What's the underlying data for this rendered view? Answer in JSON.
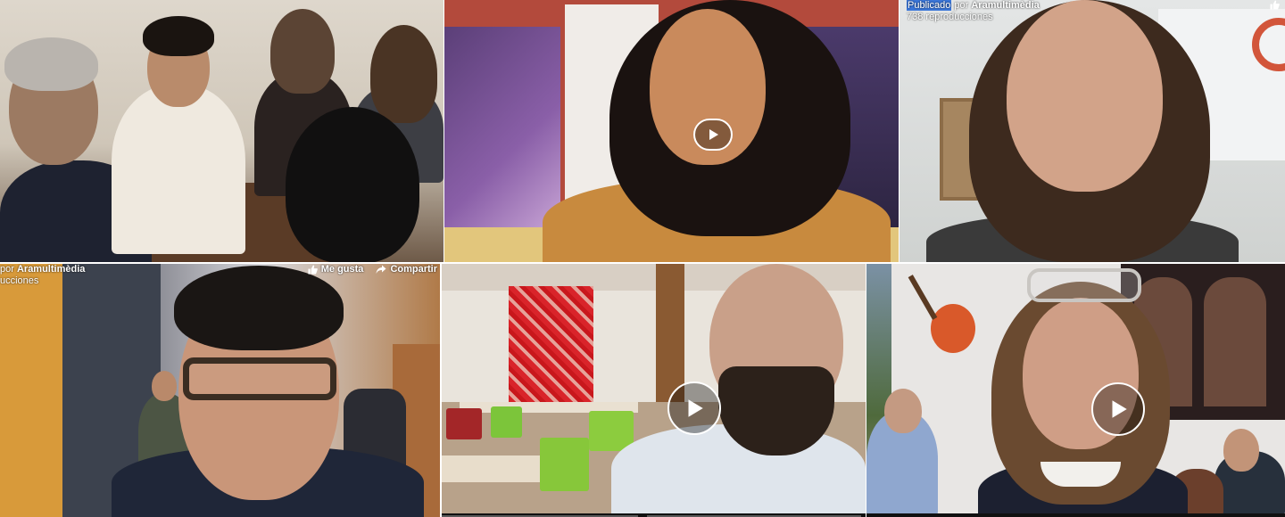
{
  "colors": {
    "facebook_highlight": "#3a76d9",
    "overlay_text": "#ffffff"
  },
  "tiles": [
    {
      "id": "tile-1",
      "has_play": false
    },
    {
      "id": "tile-2",
      "has_play": true
    },
    {
      "id": "tile-3",
      "has_play": false,
      "overlay": {
        "published_word": "Publicado",
        "by_word": "por",
        "publisher": "Aramultimèdia",
        "views": "738 reproducciones"
      },
      "like_icon": "thumbs-up-icon"
    },
    {
      "id": "tile-4",
      "has_play": false,
      "overlay": {
        "by_word": "por",
        "publisher": "Aramultimèdia",
        "views_fragment": "ucciones",
        "like_label": "Me gusta",
        "share_label": "Compartir"
      },
      "like_icon": "thumbs-up-icon",
      "share_icon": "share-arrow-icon"
    },
    {
      "id": "tile-5",
      "has_play": true
    },
    {
      "id": "tile-6",
      "has_play": true
    }
  ],
  "icons": {
    "play": "play-icon",
    "like": "thumbs-up-icon",
    "share": "share-arrow-icon"
  }
}
